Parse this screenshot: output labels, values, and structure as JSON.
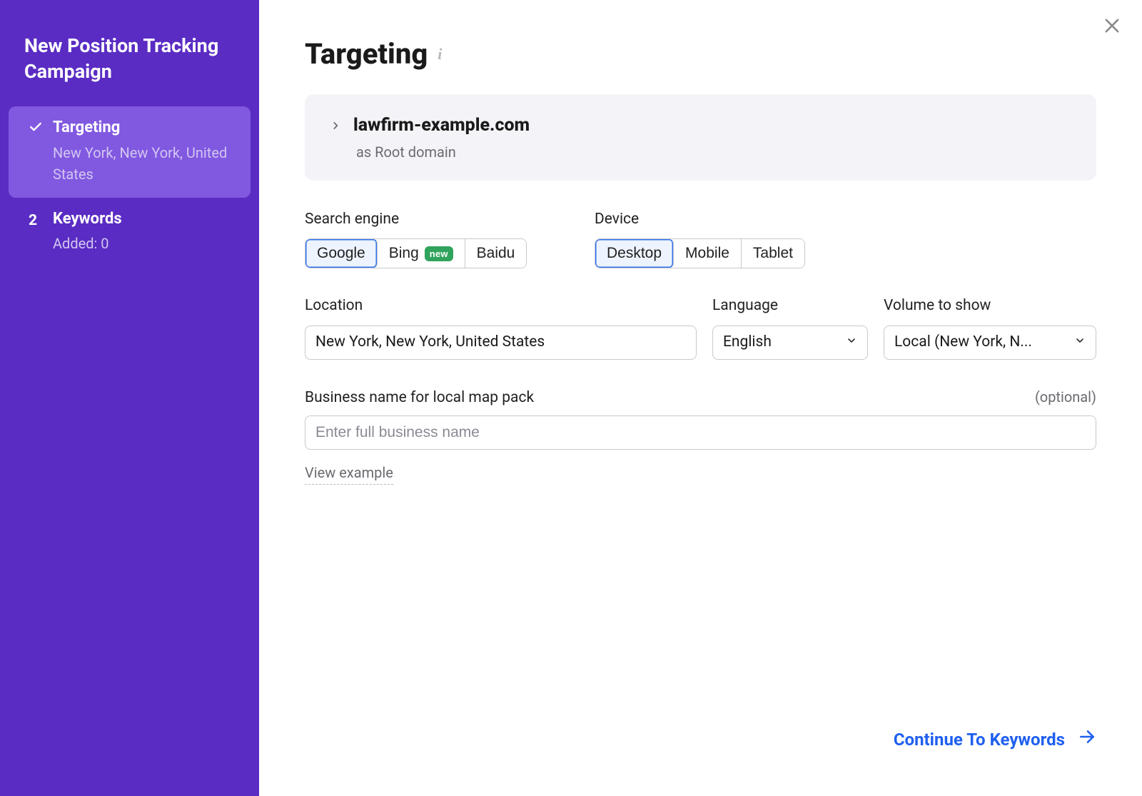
{
  "sidebar": {
    "title": "New Position Tracking Campaign",
    "steps": [
      {
        "label": "Targeting",
        "sub": "New York, New York, United States"
      },
      {
        "label": "Keywords",
        "sub": "Added: 0",
        "indicator": "2"
      }
    ]
  },
  "header": {
    "title": "Targeting"
  },
  "domain": {
    "name": "lawfirm-example.com",
    "mode": "as Root domain"
  },
  "search_engine": {
    "label": "Search engine",
    "options": [
      "Google",
      "Bing",
      "Baidu"
    ],
    "bing_badge": "new",
    "selected": "Google"
  },
  "device": {
    "label": "Device",
    "options": [
      "Desktop",
      "Mobile",
      "Tablet"
    ],
    "selected": "Desktop"
  },
  "location": {
    "label": "Location",
    "value": "New York, New York, United States"
  },
  "language": {
    "label": "Language",
    "value": "English"
  },
  "volume": {
    "label": "Volume to show",
    "value": "Local (New York, N..."
  },
  "business": {
    "label": "Business name for local map pack",
    "optional": "(optional)",
    "placeholder": "Enter full business name",
    "view_example": "View example"
  },
  "footer": {
    "continue": "Continue To Keywords"
  }
}
